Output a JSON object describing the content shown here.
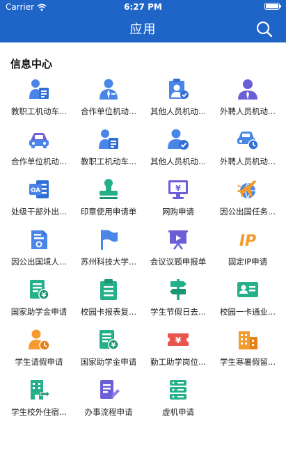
{
  "status": {
    "carrier": "Carrier",
    "time": "6:27 PM"
  },
  "nav": {
    "title": "应用"
  },
  "section": {
    "title": "信息中心"
  },
  "colors": {
    "header": "#1f65c8",
    "icon_blue": "#4a86e8",
    "icon_green": "#26b08a",
    "icon_purple": "#6b5fd6",
    "icon_orange": "#f59a2c",
    "icon_red": "#e8554e"
  },
  "apps": [
    {
      "label": "教职工机动车...",
      "icon": "staff-card-icon"
    },
    {
      "label": "合作单位机动...",
      "icon": "partner-person-icon"
    },
    {
      "label": "其他人员机动...",
      "icon": "clipboard-person-icon"
    },
    {
      "label": "外聘人员机动...",
      "icon": "external-person-icon"
    },
    {
      "label": "合作单位机动...",
      "icon": "car-icon"
    },
    {
      "label": "教职工机动车...",
      "icon": "staff-card-icon"
    },
    {
      "label": "其他人员机动...",
      "icon": "person-check-icon"
    },
    {
      "label": "外聘人员机动...",
      "icon": "car-clock-icon"
    },
    {
      "label": "处级干部外出...",
      "icon": "oa-icon"
    },
    {
      "label": "印章使用申请单",
      "icon": "stamp-icon"
    },
    {
      "label": "网购申请",
      "icon": "monitor-yen-icon"
    },
    {
      "label": "因公出国任务...",
      "icon": "plane-globe-icon"
    },
    {
      "label": "因公出国境人...",
      "icon": "certificate-icon"
    },
    {
      "label": "苏州科技大学...",
      "icon": "flag-icon"
    },
    {
      "label": "会议议题申报单",
      "icon": "presentation-icon"
    },
    {
      "label": "固定IP申请",
      "icon": "ip-icon"
    },
    {
      "label": "国家助学金申请",
      "icon": "document-yen-icon"
    },
    {
      "label": "校园卡报表复...",
      "icon": "clipboard-list-icon"
    },
    {
      "label": "学生节假日去...",
      "icon": "signpost-icon"
    },
    {
      "label": "校园一卡通业...",
      "icon": "id-card-icon"
    },
    {
      "label": "学生请假申请",
      "icon": "person-clock-icon"
    },
    {
      "label": "国家助学金申请",
      "icon": "document-yen-icon"
    },
    {
      "label": "勤工助学岗位...",
      "icon": "ticket-yen-icon"
    },
    {
      "label": "学生寒暑假留...",
      "icon": "building-icon"
    },
    {
      "label": "学生校外住宿...",
      "icon": "building-arrow-icon"
    },
    {
      "label": "办事流程申请",
      "icon": "document-pen-icon"
    },
    {
      "label": "虚机申请",
      "icon": "server-icon"
    }
  ]
}
